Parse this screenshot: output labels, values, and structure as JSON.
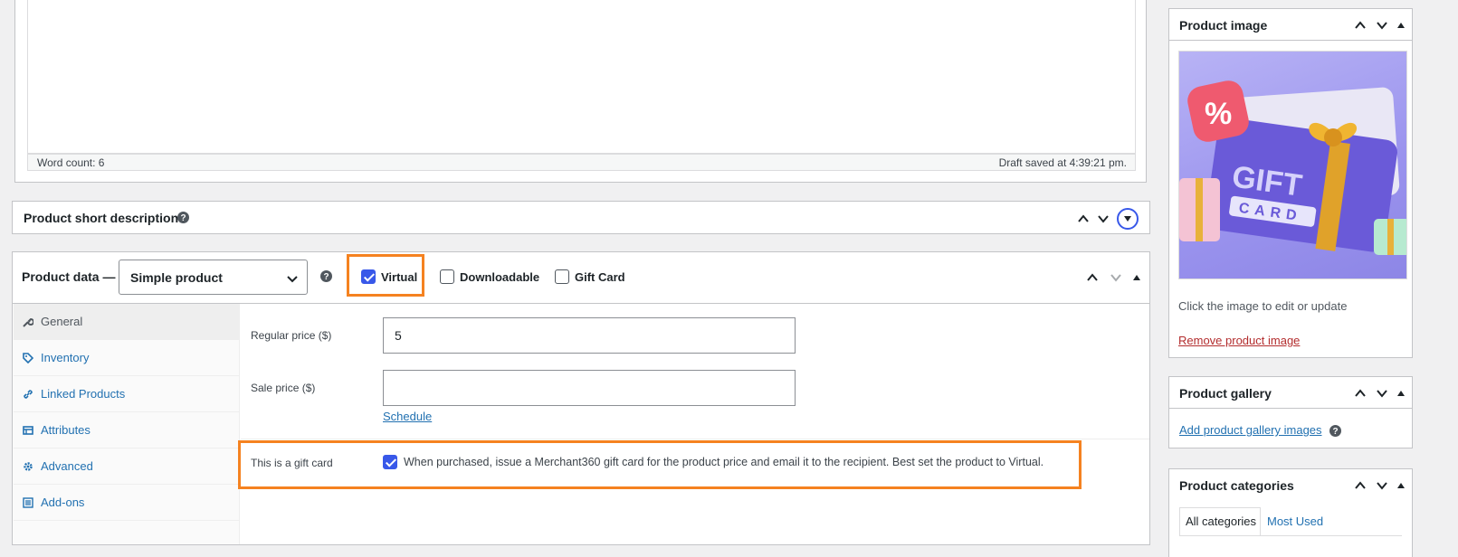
{
  "editor": {
    "word_count": "Word count: 6",
    "draft_saved": "Draft saved at 4:39:21 pm."
  },
  "short_description": {
    "title": "Product short description"
  },
  "product_data": {
    "title": "Product data —",
    "type_select": "Simple product",
    "virtual_label": "Virtual",
    "downloadable_label": "Downloadable",
    "giftcard_label": "Gift Card",
    "virtual_checked": true,
    "downloadable_checked": false,
    "giftcard_checked": false,
    "tabs": [
      {
        "label": "General",
        "icon": "wrench-icon",
        "active": true
      },
      {
        "label": "Inventory",
        "icon": "tag-icon"
      },
      {
        "label": "Linked Products",
        "icon": "link-icon"
      },
      {
        "label": "Attributes",
        "icon": "table-icon"
      },
      {
        "label": "Advanced",
        "icon": "gear-icon"
      },
      {
        "label": "Add-ons",
        "icon": "list-icon"
      }
    ],
    "regular_price_label": "Regular price ($)",
    "regular_price_value": "5",
    "sale_price_label": "Sale price ($)",
    "sale_price_value": "",
    "schedule_link": "Schedule",
    "gift_card_label": "This is a gift card",
    "gift_card_desc": "When purchased, issue a Merchant360 gift card for the product price and email it to the recipient. Best set the product to Virtual.",
    "gift_card_checked": true
  },
  "product_image": {
    "title": "Product image",
    "image_text_1": "GIFT",
    "image_text_2": "CARD",
    "hint": "Click the image to edit or update",
    "remove_link": "Remove product image"
  },
  "product_gallery": {
    "title": "Product gallery",
    "add_link": "Add product gallery images"
  },
  "product_categories": {
    "title": "Product categories",
    "tab_all": "All categories",
    "tab_most_used": "Most Used"
  },
  "colors": {
    "highlight": "#f58220",
    "link": "#2271b1",
    "checkbox": "#3858e9",
    "remove_link": "#b32d2e"
  }
}
